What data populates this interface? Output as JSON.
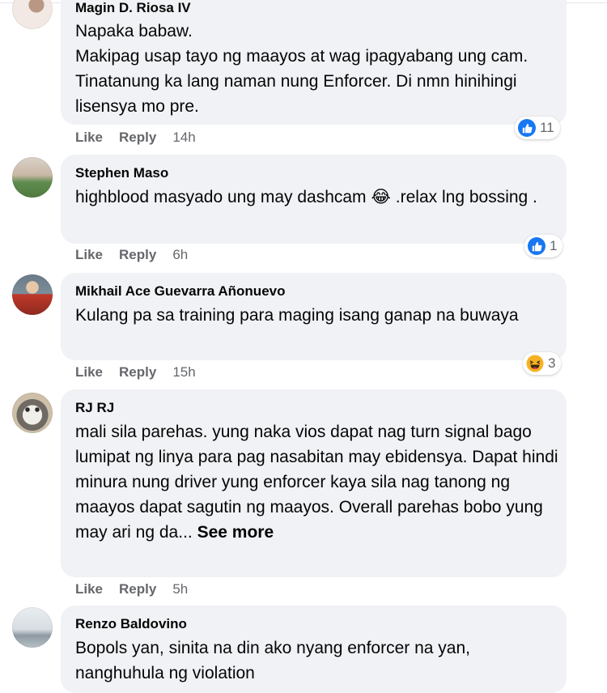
{
  "comments": [
    {
      "author": "Magin D. Riosa IV",
      "text": "Napaka babaw.\nMakipag usap tayo ng maayos at wag ipagyabang ung cam. Tinatanung ka lang naman nung Enforcer. Di nmn hinihingi lisensya mo pre.",
      "like_label": "Like",
      "reply_label": "Reply",
      "time": "14h",
      "reaction": {
        "icon": "like-icon",
        "count": "11"
      }
    },
    {
      "author": "Stephen Maso",
      "text": "highblood masyado ung may dashcam",
      "emoji": "😂",
      "text_after": " .relax lng bossing .",
      "like_label": "Like",
      "reply_label": "Reply",
      "time": "6h",
      "reaction": {
        "icon": "like-icon",
        "count": "1"
      }
    },
    {
      "author": "Mikhail Ace Guevarra Añonuevo",
      "text": "Kulang pa sa training para maging isang ganap na buwaya",
      "like_label": "Like",
      "reply_label": "Reply",
      "time": "15h",
      "reaction": {
        "icon": "haha-icon",
        "count": "3"
      }
    },
    {
      "author": "RJ RJ",
      "text": "mali sila parehas. yung naka vios dapat nag turn signal bago lumipat ng linya para pag nasabitan may ebidensya. Dapat hindi minura nung driver yung enforcer kaya sila nag tanong ng maayos dapat sagutin ng maayos. Overall parehas bobo yung may ari ng da... ",
      "see_more": "See more",
      "like_label": "Like",
      "reply_label": "Reply",
      "time": "5h"
    },
    {
      "author": "Renzo Baldovino",
      "text": "Bopols yan, sinita na din ako nyang enforcer na yan, nanghuhula ng violation"
    }
  ],
  "colors": {
    "bubble": "#f0f2f5",
    "secondary_text": "#65676b",
    "like_blue": "#1877f2",
    "haha_yellow": "#f7b125"
  }
}
